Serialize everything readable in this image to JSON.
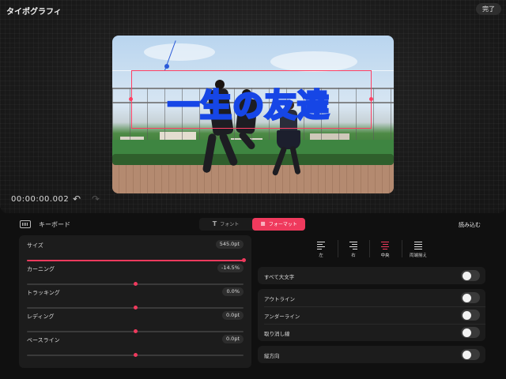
{
  "header": {
    "title": "タイポグラフィ",
    "done_label": "完了"
  },
  "preview": {
    "overlay_text": "一生の友達",
    "timecode": "00:00:00.002"
  },
  "icons": {
    "undo": "undo-icon",
    "redo": "redo-icon",
    "keyboard": "keyboard-icon"
  },
  "toolbar": {
    "keyboard_label": "キーボード",
    "tabs": [
      {
        "label": "フォント",
        "icon": "T",
        "active": false
      },
      {
        "label": "フォーマット",
        "icon": "≡",
        "active": true
      }
    ],
    "load_label": "読み込む"
  },
  "sliders": [
    {
      "label": "サイズ",
      "value": "545.0pt",
      "position": 1.0
    },
    {
      "label": "カーニング",
      "value": "-14.5%",
      "position": 0.5
    },
    {
      "label": "トラッキング",
      "value": "0.0%",
      "position": 0.5
    },
    {
      "label": "レディング",
      "value": "0.0pt",
      "position": 0.5
    },
    {
      "label": "ベースライン",
      "value": "0.0pt",
      "position": 0.5
    }
  ],
  "alignment": [
    {
      "label": "左",
      "active": false
    },
    {
      "label": "右",
      "active": false
    },
    {
      "label": "中央",
      "active": true
    },
    {
      "label": "両端揃え",
      "active": false
    }
  ],
  "toggles": {
    "all_caps": "すべて大文字",
    "outline": "アウトライン",
    "underline": "アンダーライン",
    "strikethrough": "取り消し線",
    "vertical": "縦方向"
  },
  "colors": {
    "accent": "#ef3a5d",
    "text_stroke": "#1646e6"
  }
}
